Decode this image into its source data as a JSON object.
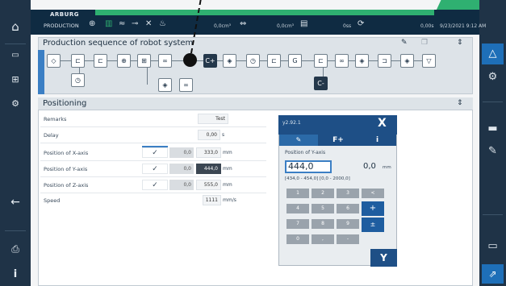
{
  "topbar": {
    "logo": "ARBURG",
    "mode": "PRODUCTION",
    "value_a": "0,0cm³",
    "value_b": "0,0cm³",
    "value_c": "0ss",
    "value_d": "0,00s",
    "datetime": "9/23/2021  9:12 AM"
  },
  "sequence": {
    "title": "Production sequence of robot system",
    "edit_icon": "pencil-icon",
    "copy_icon": "copy-icon",
    "collapse_icon": "chevron-up-down-icon",
    "blocks": [
      {
        "glyph": "◇",
        "name": "start-block"
      },
      {
        "glyph": "⊏",
        "name": "gripper-block-1"
      },
      {
        "glyph": "⊏",
        "name": "gripper-block-2"
      },
      {
        "glyph": "⊕",
        "name": "vacuum-block"
      },
      {
        "glyph": "⊞",
        "name": "axis-block-1"
      },
      {
        "glyph": "∞",
        "name": "position-block-1"
      },
      {
        "glyph": "C+",
        "name": "counter-plus-block"
      },
      {
        "glyph": "◈",
        "name": "branch-block-1"
      },
      {
        "glyph": "◷",
        "name": "wait-block-1"
      },
      {
        "glyph": "⊏",
        "name": "gripper-block-3"
      },
      {
        "glyph": "G",
        "name": "signal-block"
      },
      {
        "glyph": "⊏",
        "name": "gripper-block-4"
      },
      {
        "glyph": "∞",
        "name": "position-block-2"
      },
      {
        "glyph": "◈",
        "name": "branch-block-2"
      },
      {
        "glyph": "⊐",
        "name": "place-block"
      },
      {
        "glyph": "◈",
        "name": "branch-block-3"
      },
      {
        "glyph": "▽",
        "name": "end-block"
      },
      {
        "glyph": "◷",
        "name": "wait-block-2"
      },
      {
        "glyph": "◈",
        "name": "branch-block-4"
      },
      {
        "glyph": "∞",
        "name": "position-block-3"
      },
      {
        "glyph": "C-",
        "name": "counter-minus-block"
      }
    ]
  },
  "positioning": {
    "title": "Positioning",
    "rows": [
      {
        "label": "Remarks",
        "value": "Test",
        "unit": ""
      },
      {
        "label": "Delay",
        "value": "0,00",
        "unit": "s"
      },
      {
        "label": "Position of X-axis",
        "check": "✓",
        "grey": "0,0",
        "value": "333,0",
        "unit": "mm"
      },
      {
        "label": "Position of Y-axis",
        "check": "✓",
        "grey": "0,0",
        "value": "444,0",
        "unit": "mm"
      },
      {
        "label": "Position of Z-axis",
        "check": "✓",
        "grey": "0,0",
        "value": "555,0",
        "unit": "mm"
      },
      {
        "label": "Speed",
        "value": "1111",
        "unit": "mm/s"
      }
    ]
  },
  "keypad": {
    "id": "y2.92.1",
    "close": "X",
    "tab_edit": "✎",
    "tab_f": "F+",
    "tab_info": "i",
    "label": "Position of Y-axis",
    "input_value": "444,0",
    "display_value": "0,0",
    "unit": "mm",
    "range": "[434,0 - 454,0]  [0,0 - 2000,0]",
    "keys": [
      "1",
      "2",
      "3",
      "<",
      "4",
      "5",
      "6",
      "+",
      "7",
      "8",
      "9",
      "±",
      "0",
      ",",
      "-"
    ],
    "confirm": "Y"
  },
  "left_nav": [
    "home-icon",
    "menu-icon",
    "sequence-icon",
    "robot-icon",
    "back-icon",
    "print-icon",
    "info-icon"
  ],
  "right_nav": [
    "axis-icon",
    "settings-icon",
    "tools-icon",
    "edit-icon",
    "screen-icon",
    "export-icon"
  ]
}
